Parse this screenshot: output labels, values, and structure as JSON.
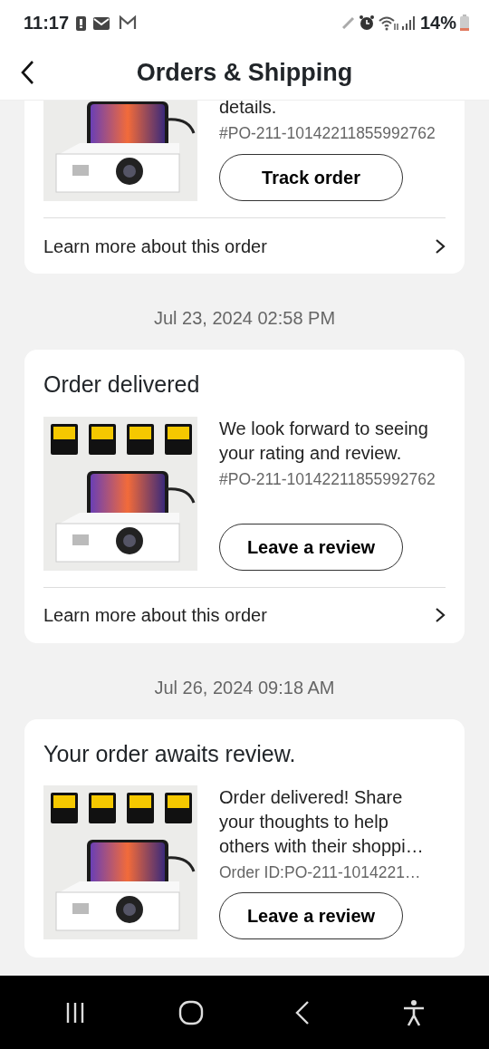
{
  "status_bar": {
    "time": "11:17",
    "battery": "14%"
  },
  "header": {
    "title": "Orders & Shipping"
  },
  "feed": [
    {
      "kind": "order",
      "clipped": true,
      "message": "details.",
      "order_id": "#PO-211-10142211855992762",
      "button": "Track order",
      "link": "Learn more about this order"
    },
    {
      "kind": "date",
      "text": "Jul 23, 2024 02:58 PM"
    },
    {
      "kind": "order",
      "clipped": false,
      "title": "Order delivered",
      "message": "We look forward to seeing your rating and review.",
      "order_id": "#PO-211-10142211855992762",
      "button": "Leave a review",
      "link": "Learn more about this order"
    },
    {
      "kind": "date",
      "text": "Jul 26, 2024 09:18 AM"
    },
    {
      "kind": "order",
      "clipped": false,
      "title": "Your order awaits review.",
      "message": "Order delivered! Share your thoughts to help others with their shoppi…",
      "order_id": "Order ID:PO-211-1014221…",
      "button": "Leave a review"
    }
  ]
}
